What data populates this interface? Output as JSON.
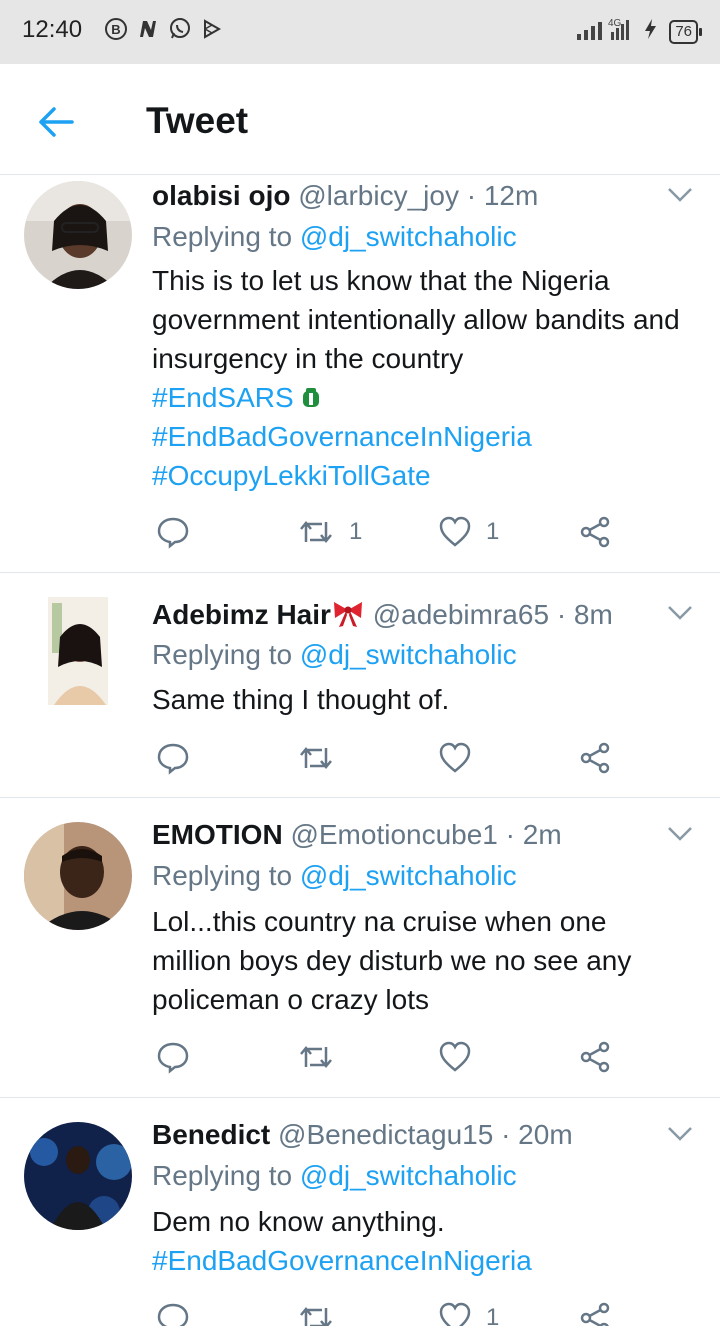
{
  "status_bar": {
    "time": "12:40",
    "battery": "76",
    "network": "4G",
    "icons": [
      "b-circle-icon",
      "n-icon",
      "whatsapp-icon",
      "play-icon"
    ]
  },
  "header": {
    "title": "Tweet"
  },
  "colors": {
    "accent": "#1da1f2",
    "secondary_text": "#657786",
    "divider": "#e1e8ed"
  },
  "tweets": [
    {
      "name": "olabisi ojo",
      "handle": "@larbicy_joy",
      "dot": "·",
      "time": "12m",
      "replying_prefix": "Replying to ",
      "replying_to": "@dj_switchaholic",
      "text": "This is to let us know that the Nigeria government intentionally allow bandits and insurgency in the country",
      "hashtags": [
        "#EndSARS",
        "#EndBadGovernanceInNigeria",
        "#OccupyLekkiTollGate"
      ],
      "retweets": "1",
      "likes": "1"
    },
    {
      "name": "Adebimz Hair",
      "handle": "@adebimra65",
      "dot": "·",
      "time": "8m",
      "replying_prefix": "Replying to ",
      "replying_to": "@dj_switchaholic",
      "text": "Same thing I thought of."
    },
    {
      "name": "EMOTION",
      "handle": "@Emotioncube1",
      "dot": "·",
      "time": "2m",
      "replying_prefix": "Replying to ",
      "replying_to": "@dj_switchaholic",
      "text": "Lol...this country na cruise when one million boys dey disturb we no see any policeman o crazy lots"
    },
    {
      "name": "Benedict",
      "handle": "@Benedictagu15",
      "dot": "·",
      "time": "20m",
      "replying_prefix": "Replying to ",
      "replying_to": "@dj_switchaholic",
      "text": "Dem no know anything.",
      "hashtags": [
        "#EndBadGovernanceInNigeria"
      ],
      "likes": "1"
    }
  ]
}
